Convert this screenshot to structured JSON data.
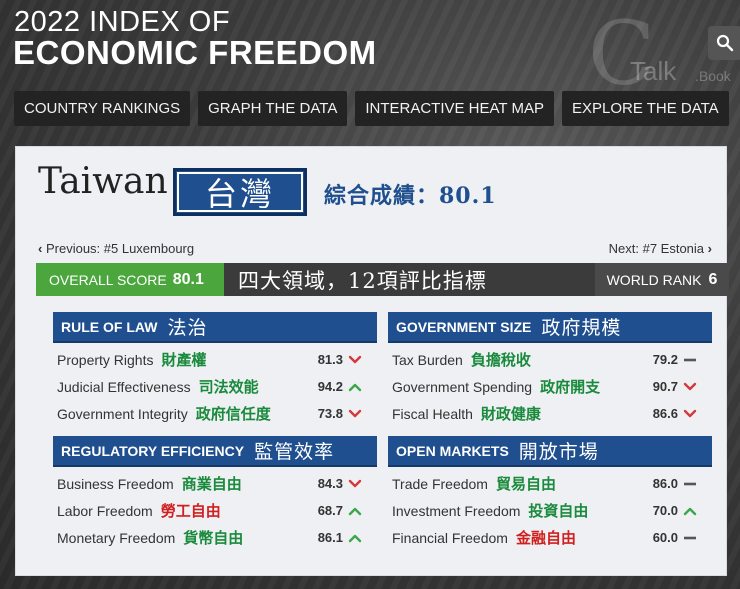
{
  "header": {
    "title_line1": "2022 INDEX OF",
    "title_line2": "ECONOMIC FREEDOM",
    "watermark_talk": "Talk",
    "watermark_book": ".Book",
    "nav": [
      "COUNTRY RANKINGS",
      "GRAPH THE DATA",
      "INTERACTIVE HEAT MAP",
      "EXPLORE THE DATA"
    ],
    "search_icon": "search-icon"
  },
  "country": {
    "name": "Taiwan",
    "name_zh": "台灣",
    "score_zh": "綜合成績：80.1",
    "previous": "Previous: #5 Luxembourg",
    "next": "Next: #7 Estonia"
  },
  "scorebar": {
    "overall_label": "OVERALL SCORE",
    "overall_value": "80.1",
    "subtitle_zh": "四大領域，12項評比指標",
    "rank_label": "WORLD RANK",
    "rank_value": "6"
  },
  "panels": [
    {
      "title": "RULE OF LAW",
      "title_zh": "法治",
      "rows": [
        {
          "name": "Property Rights",
          "zh": "財產權",
          "zh_color": "green",
          "value": "81.3",
          "trend": "down"
        },
        {
          "name": "Judicial Effectiveness",
          "zh": "司法效能",
          "zh_color": "green",
          "value": "94.2",
          "trend": "up"
        },
        {
          "name": "Government Integrity",
          "zh": "政府信任度",
          "zh_color": "green",
          "value": "73.8",
          "trend": "down"
        }
      ]
    },
    {
      "title": "GOVERNMENT SIZE",
      "title_zh": "政府規模",
      "rows": [
        {
          "name": "Tax Burden",
          "zh": "負擔稅收",
          "zh_color": "green",
          "value": "79.2",
          "trend": "flat"
        },
        {
          "name": "Government Spending",
          "zh": "政府開支",
          "zh_color": "green",
          "value": "90.7",
          "trend": "down"
        },
        {
          "name": "Fiscal Health",
          "zh": "財政健康",
          "zh_color": "green",
          "value": "86.6",
          "trend": "down"
        }
      ]
    },
    {
      "title": "REGULATORY EFFICIENCY",
      "title_zh": "監管效率",
      "rows": [
        {
          "name": "Business Freedom",
          "zh": "商業自由",
          "zh_color": "green",
          "value": "84.3",
          "trend": "down"
        },
        {
          "name": "Labor Freedom",
          "zh": "勞工自由",
          "zh_color": "red",
          "value": "68.7",
          "trend": "up"
        },
        {
          "name": "Monetary Freedom",
          "zh": "貨幣自由",
          "zh_color": "green",
          "value": "86.1",
          "trend": "up"
        }
      ]
    },
    {
      "title": "OPEN MARKETS",
      "title_zh": "開放市場",
      "rows": [
        {
          "name": "Trade Freedom",
          "zh": "貿易自由",
          "zh_color": "green",
          "value": "86.0",
          "trend": "flat"
        },
        {
          "name": "Investment Freedom",
          "zh": "投資自由",
          "zh_color": "green",
          "value": "70.0",
          "trend": "up"
        },
        {
          "name": "Financial Freedom",
          "zh": "金融自由",
          "zh_color": "red",
          "value": "60.0",
          "trend": "flat"
        }
      ]
    }
  ],
  "colors": {
    "navy": "#1f4f8e",
    "green": "#4ba63e",
    "zh_green": "#1a8a3c",
    "zh_red": "#d01f1f",
    "trend_down": "#d33a3a",
    "trend_up": "#3ba84a",
    "trend_flat": "#555555"
  }
}
